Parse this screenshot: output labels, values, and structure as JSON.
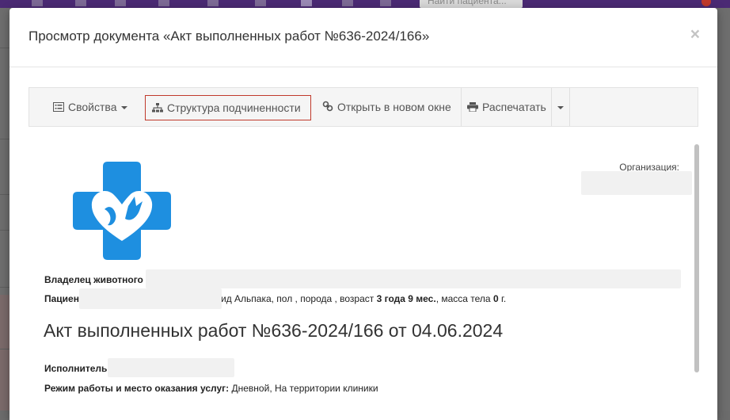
{
  "background": {
    "search_placeholder": "Найти пациента..."
  },
  "modal": {
    "title": "Просмотр документа «Акт выполненных работ №636-2024/166»",
    "close_label": "×"
  },
  "toolbar": {
    "properties_label": "Свойства",
    "hierarchy_label": "Структура подчиненности",
    "open_new_window_label": "Открыть в новом окне",
    "print_label": "Распечатать"
  },
  "document": {
    "organization_label": "Организация:",
    "owner_label": "Владелец животного",
    "patient_label": "Пациен",
    "patient_species": "ид Альпака, пол , порода , возраст ",
    "patient_age": "3 года 9 мес.",
    "patient_weight_prefix": ", масса тела ",
    "patient_weight": "0",
    "patient_weight_unit": " г.",
    "title": "Акт выполненных работ №636-2024/166 от 04.06.2024",
    "executor_label": "Исполнитель",
    "service_mode_label": "Режим работы и место оказания услуг:",
    "service_mode_value": " Дневной, На территории клиники"
  },
  "colors": {
    "logo_blue": "#1e8fe0",
    "active_border": "#c0392b",
    "topbar": "#4b2a74"
  },
  "icons": {
    "properties": "list-icon",
    "hierarchy": "sitemap-icon",
    "open_new_window": "link-icon",
    "print": "printer-icon",
    "more": "caret-down-icon",
    "close": "close-icon"
  }
}
